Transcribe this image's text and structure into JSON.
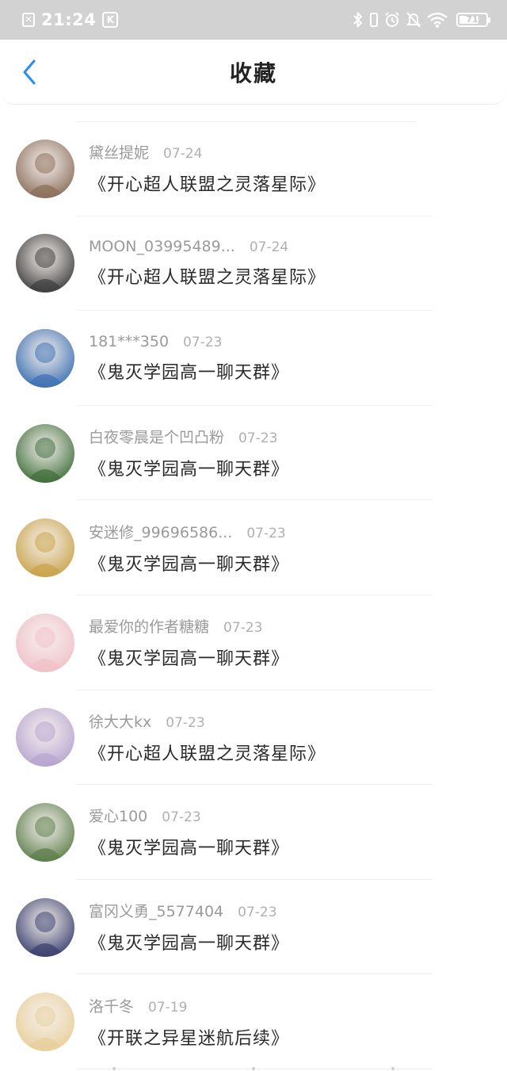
{
  "status_bar": {
    "time": "21:24",
    "notif_badge": "K",
    "battery": "71",
    "icons": [
      "close-notification-icon",
      "bluetooth-icon",
      "alarm-icon",
      "mute-icon",
      "wifi-icon",
      "battery-icon"
    ]
  },
  "header": {
    "title": "收藏",
    "back_icon": "chevron-left-icon"
  },
  "colors": {
    "accent_blue": "#2a8cf0",
    "status_bar_bg": "#d2d2d2",
    "username_gray": "#9a9a9a",
    "title_dark": "#2a2a2a"
  },
  "items": [
    {
      "username": "黛丝提妮",
      "date": "07-24",
      "title": "《开心超人联盟之灵落星际》",
      "avatar_color": "#8a6e5a"
    },
    {
      "username": "MOON_03995489...",
      "date": "07-24",
      "title": "《开心超人联盟之灵落星际》",
      "avatar_color": "#3c3c3c"
    },
    {
      "username": "181***350",
      "date": "07-23",
      "title": "《鬼灭学园高一聊天群》",
      "avatar_color": "#3c6fb0"
    },
    {
      "username": "白夜零晨是个凹凸粉",
      "date": "07-23",
      "title": "《鬼灭学园高一聊天群》",
      "avatar_color": "#3f6e3a"
    },
    {
      "username": "安迷修_99696586...",
      "date": "07-23",
      "title": "《鬼灭学园高一聊天群》",
      "avatar_color": "#c9a34a"
    },
    {
      "username": "最爱你的作者糖糖",
      "date": "07-23",
      "title": "《鬼灭学园高一聊天群》",
      "avatar_color": "#f0c0c8"
    },
    {
      "username": "徐大大kx",
      "date": "07-23",
      "title": "《开心超人联盟之灵落星际》",
      "avatar_color": "#b6a4cf"
    },
    {
      "username": "爱心100",
      "date": "07-23",
      "title": "《鬼灭学园高一聊天群》",
      "avatar_color": "#5d7d4a"
    },
    {
      "username": "富冈义勇_5577404",
      "date": "07-23",
      "title": "《鬼灭学园高一聊天群》",
      "avatar_color": "#3a3f6e"
    },
    {
      "username": "洛千冬",
      "date": "07-19",
      "title": "《开联之异星迷航后续》",
      "avatar_color": "#e8cf9a"
    }
  ]
}
